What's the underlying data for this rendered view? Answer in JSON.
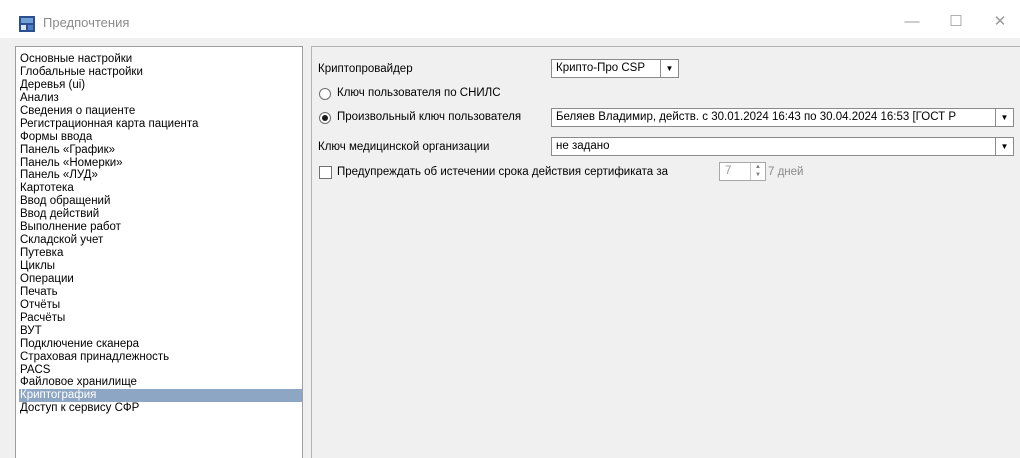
{
  "window": {
    "title": "Предпочтения",
    "icon": "app-icon",
    "controls": {
      "minimize": "—",
      "maximize": "☐",
      "close": "✕"
    }
  },
  "sidebar": {
    "items": [
      "Основные настройки",
      "Глобальные настройки",
      "Деревья (ui)",
      "Анализ",
      "Сведения о пациенте",
      "Регистрационная карта пациента",
      "Формы ввода",
      "Панель «График»",
      "Панель «Номерки»",
      "Панель «ЛУД»",
      "Картотека",
      "Ввод обращений",
      "Ввод действий",
      "Выполнение работ",
      "Складской учет",
      "Путевка",
      "Циклы",
      "Операции",
      "Печать",
      "Отчёты",
      "Расчёты",
      "ВУТ",
      "Подключение сканера",
      "Страховая принадлежность",
      "PACS",
      "Файловое хранилище",
      "Криптография",
      "Доступ к сервису СФР"
    ],
    "selected_index": 26,
    "selected_color": "#8da6c4"
  },
  "crypto": {
    "provider_label": "Криптопровайдер",
    "provider_value": "Крипто-Про CSP",
    "snils_key_label": "Ключ пользователя по СНИЛС",
    "custom_key_label": "Произвольный ключ пользователя",
    "custom_key_value": "Беляев Владимир, действ. с 30.01.2024 16:43 по 30.04.2024 16:53 [ГОСТ Р",
    "org_key_label": "Ключ медицинской организации",
    "org_key_value": "не задано",
    "warn_label": "Предупреждать об истечении срока действия сертификата за",
    "warn_days_value": "7",
    "warn_days_unit": "7 дней",
    "warn_checked": false,
    "selected_key_mode": "custom"
  }
}
